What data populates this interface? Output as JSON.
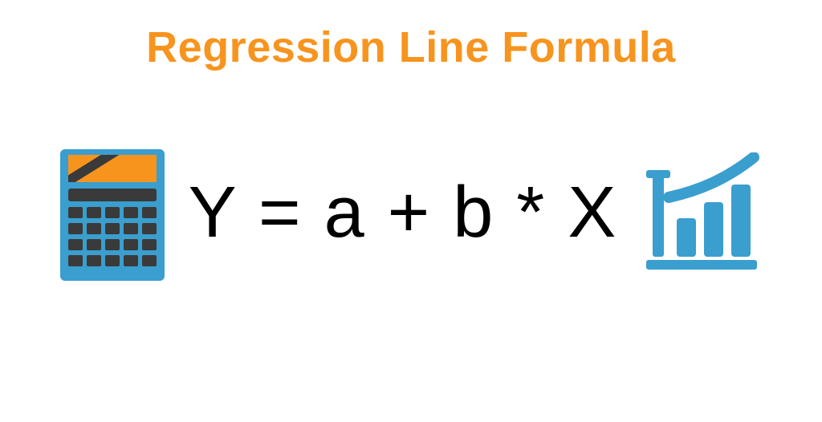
{
  "title": "Regression Line Formula",
  "formula": "Y  =  a + b  *  X",
  "icons": {
    "left": "calculator-icon",
    "right": "growth-chart-icon"
  },
  "colors": {
    "title": "#f7941e",
    "formula": "#000000",
    "icon_blue": "#3a9ecf",
    "icon_orange": "#f7941e",
    "icon_dark": "#3a3a3a"
  }
}
